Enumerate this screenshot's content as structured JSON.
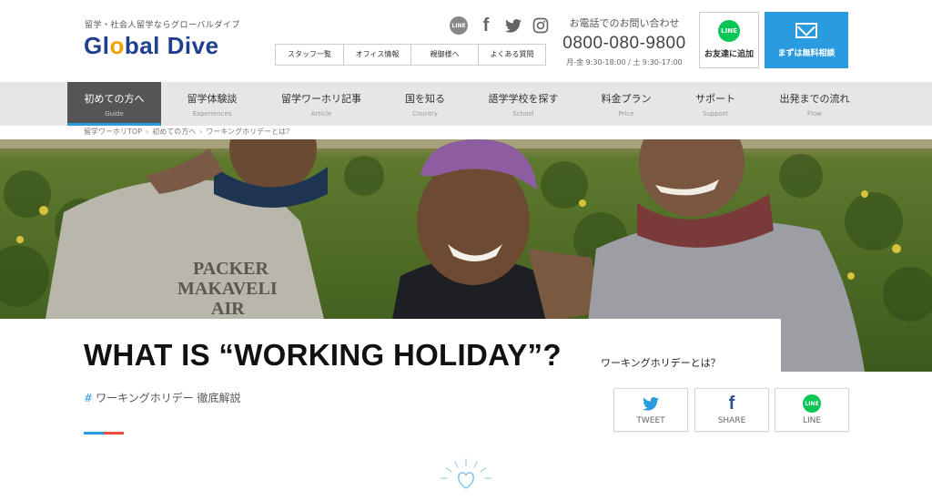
{
  "header": {
    "tagline": "留学・社会人留学ならグローバルダイブ",
    "logo": {
      "part1": "Gl",
      "part2": "o",
      "part3": "bal Dive"
    },
    "social_icons": [
      "line-icon",
      "facebook-icon",
      "twitter-icon",
      "instagram-icon"
    ],
    "social_line_text": "LINE",
    "social_fb_text": "f",
    "subnav": [
      "スタッフ一覧",
      "オフィス情報",
      "親御様へ",
      "よくある質問"
    ],
    "contact": {
      "label": "お電話でのお問い合わせ",
      "phone": "0800-080-9800",
      "hours": "月-金 9:30-18:00 / 土 9:30-17:00"
    },
    "line_button": {
      "icon_text": "LINE",
      "label": "お友達に追加"
    },
    "consult_button": {
      "label": "まずは無料相談"
    }
  },
  "nav": [
    {
      "ja": "初めての方へ",
      "en": "Guide",
      "active": true
    },
    {
      "ja": "留学体験談",
      "en": "Experiences"
    },
    {
      "ja": "留学ワーホリ記事",
      "en": "Article"
    },
    {
      "ja": "国を知る",
      "en": "Country"
    },
    {
      "ja": "語学学校を探す",
      "en": "School"
    },
    {
      "ja": "料金プラン",
      "en": "Price"
    },
    {
      "ja": "サポート",
      "en": "Support"
    },
    {
      "ja": "出発までの流れ",
      "en": "Flow"
    }
  ],
  "breadcrumb": {
    "items": [
      "留学ワーホリTOP",
      "初めての方へ",
      "ワーキングホリデーとは？"
    ],
    "separator": "›"
  },
  "hero": {
    "shirt_text": [
      "PACKER",
      "MAKAVELI",
      "AIR"
    ]
  },
  "article": {
    "title": "WHAT IS “WORKING HOLIDAY”?",
    "subtitle": "ワーキングホリデーとは？",
    "tag_hash": "#",
    "tag": "ワーキングホリデー 徹底解説"
  },
  "share": [
    {
      "label": "TWEET",
      "icon": "twitter-icon"
    },
    {
      "label": "SHARE",
      "icon": "facebook-icon",
      "glyph": "f"
    },
    {
      "label": "LINE",
      "icon": "line-icon",
      "glyph": "LINE"
    }
  ],
  "colors": {
    "brand_navy": "#1f3f8f",
    "accent_blue": "#2b9be0",
    "accent_red": "#e74c3c",
    "line_green": "#06c755"
  }
}
